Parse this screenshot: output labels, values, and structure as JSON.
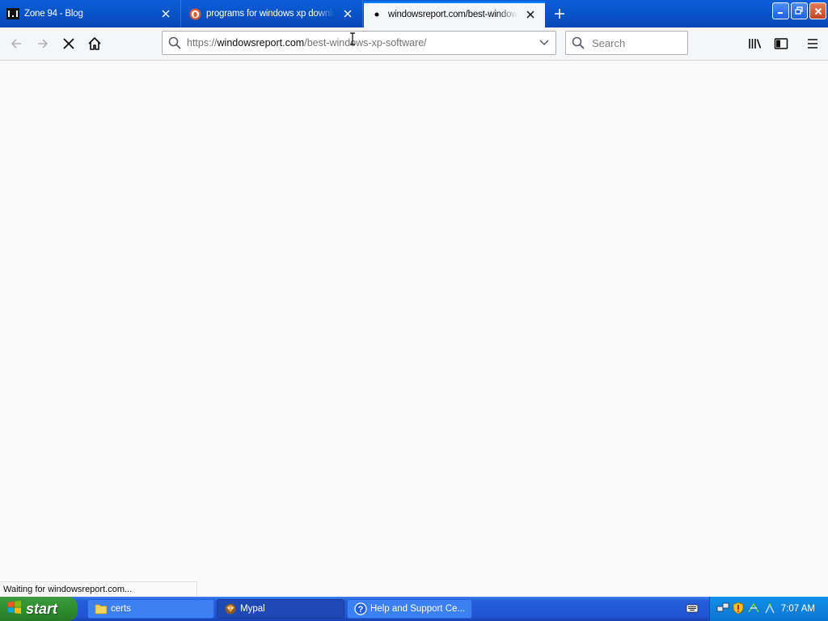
{
  "browser": {
    "tabs": [
      {
        "title": "Zone 94 - Blog",
        "icon": "zone94-favicon",
        "active": false
      },
      {
        "title": "programs for windows xp downloa",
        "icon": "duckduckgo-favicon",
        "active": false
      },
      {
        "title": "windowsreport.com/best-windows",
        "icon": "loading-dot",
        "active": true
      }
    ],
    "url": {
      "scheme": "https://",
      "host": "windowsreport.com",
      "path": "/best-windows-xp-software/"
    },
    "search_placeholder": "Search",
    "status_text": "Waiting for windowsreport.com..."
  },
  "taskbar": {
    "start_label": "start",
    "tasks": [
      {
        "label": "certs",
        "icon": "folder-icon",
        "active": false
      },
      {
        "label": "Mypal",
        "icon": "mypal-icon",
        "active": true
      },
      {
        "label": "Help and Support Ce...",
        "icon": "help-icon",
        "active": false
      }
    ],
    "clock": "7:07 AM"
  },
  "colors": {
    "tab_strip": "#0a5fd8",
    "active_tab_accent": "#0a84ff",
    "taskbar": "#245edb",
    "start_button": "#2f8f2f",
    "tray": "#0c74d3"
  }
}
